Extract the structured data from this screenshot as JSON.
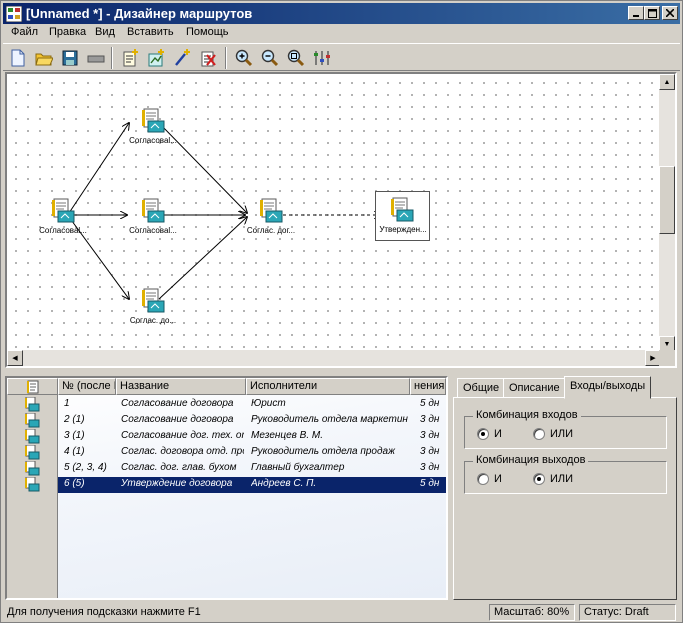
{
  "window": {
    "title": "[Unnamed *] - Дизайнер маршрутов",
    "controls": [
      "minimize-icon",
      "maximize-icon",
      "close-icon"
    ]
  },
  "menu": {
    "items": [
      "Файл",
      "Правка",
      "Вид",
      "Вставить",
      "Помощь"
    ]
  },
  "toolbar": {
    "tools": [
      "new-icon",
      "open-icon",
      "save-icon",
      "flag-icon",
      "add-stage-icon",
      "add-connection-icon",
      "add-arrow-icon",
      "delete-icon",
      "zoom-in-icon",
      "zoom-out-icon",
      "zoom-fit-icon",
      "properties-icon"
    ]
  },
  "diagram": {
    "nodes": [
      {
        "id": "n1",
        "label": "Согласоваl..."
      },
      {
        "id": "n2",
        "label": "Согласоваl..."
      },
      {
        "id": "n3",
        "label": "Согласоваl..."
      },
      {
        "id": "n4",
        "label": "Соглас. до..."
      },
      {
        "id": "n5",
        "label": "Соглас. дог..."
      },
      {
        "id": "n6",
        "label": "Утвержден..."
      }
    ]
  },
  "list": {
    "columns": [
      "№ (после №",
      "Название",
      "Исполнители",
      "нения"
    ],
    "rows": [
      {
        "num": "1",
        "name": "Согласование договора",
        "exec": "Юрист",
        "days": "5 дн",
        "selected": false
      },
      {
        "num": "2 (1)",
        "name": "Согласование договора",
        "exec": "Руководитель отдела маркетинга",
        "days": "3 дн",
        "selected": false
      },
      {
        "num": "3 (1)",
        "name": "Согласование дог. тех. отдела",
        "exec": "Мезенцев В. М.",
        "days": "3 дн",
        "selected": false
      },
      {
        "num": "4 (1)",
        "name": "Соглас. договора отд. продаж",
        "exec": "Руководитель отдела продаж",
        "days": "3 дн",
        "selected": false
      },
      {
        "num": "5 (2, 3, 4)",
        "name": "Соглас. дог. глав. бухом",
        "exec": "Главный бухгалтер",
        "days": "3 дн",
        "selected": false
      },
      {
        "num": "6 (5)",
        "name": "Утверждение договора",
        "exec": "Андреев С. П.",
        "days": "5 дн",
        "selected": true
      }
    ]
  },
  "props": {
    "tabs": [
      "Общие",
      "Описание",
      "Входы/выходы"
    ],
    "active_tab": "Входы/выходы",
    "inputs_group": {
      "label": "Комбинация входов",
      "opt_and": "И",
      "opt_or": "ИЛИ",
      "selected": "И"
    },
    "outputs_group": {
      "label": "Комбинация выходов",
      "opt_and": "И",
      "opt_or": "ИЛИ",
      "selected": "ИЛИ"
    }
  },
  "status": {
    "hint": "Для получения подсказки нажмите F1",
    "zoom": "Масштаб: 80%",
    "state": "Статус: Draft"
  }
}
